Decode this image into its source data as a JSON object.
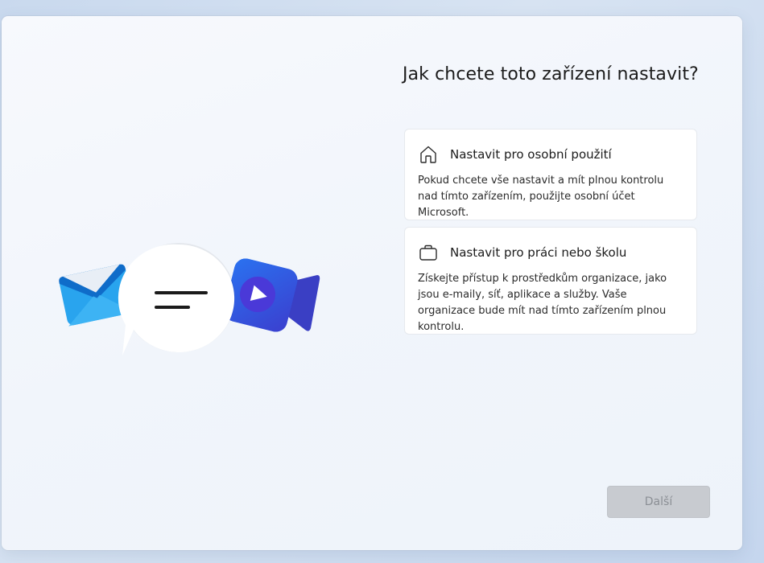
{
  "header": {
    "title": "Jak chcete toto zařízení nastavit?"
  },
  "options": [
    {
      "icon": "home-icon",
      "title": "Nastavit pro osobní použití",
      "description": "Pokud chcete vše nastavit a mít plnou kontrolu nad tímto zařízením, použijte osobní účet Microsoft."
    },
    {
      "icon": "briefcase-icon",
      "title": "Nastavit pro práci nebo školu",
      "description": "Získejte přístup k prostředkům organizace, jako jsou e-maily, síť, aplikace a služby. Vaše organizace bude mít nad tímto zařízením plnou kontrolu."
    }
  ],
  "illustration": {
    "icons": [
      "mail-icon",
      "chat-bubble-icon",
      "video-camera-icon"
    ]
  },
  "footer": {
    "next_label": "Další",
    "next_enabled": false
  },
  "colors": {
    "button_disabled_bg": "#c8cbd0",
    "button_disabled_text": "#8b8f95",
    "mail_blue": "#1f9be6",
    "video_blue": "#2f57d8"
  }
}
